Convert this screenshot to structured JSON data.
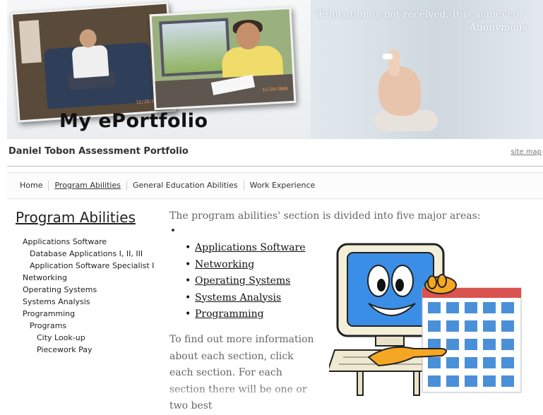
{
  "banner": {
    "title": "My ePortfolio",
    "quote_line1": "“Education is not received. It is achieved.”",
    "quote_line2": "-Anonymous",
    "photo1_stamp": "11/29/2008",
    "photo2_stamp": "11/29/2008"
  },
  "header": {
    "site_title": "Daniel Tobon Assessment Portfolio",
    "site_map": "site map"
  },
  "nav": {
    "items": [
      {
        "label": "Home"
      },
      {
        "label": "Program Abilities"
      },
      {
        "label": "General Education Abilities"
      },
      {
        "label": "Work Experience"
      }
    ]
  },
  "sidebar": {
    "heading": "Program Abilities",
    "items": [
      {
        "label": "Applications Software",
        "level": 1
      },
      {
        "label": "Database Applications I, II, III",
        "level": 2
      },
      {
        "label": "Application Software Specialist I",
        "level": 2
      },
      {
        "label": "Networking",
        "level": 1
      },
      {
        "label": "Operating Systems",
        "level": 1
      },
      {
        "label": "Systems Analysis",
        "level": 1
      },
      {
        "label": "Programming",
        "level": 1
      },
      {
        "label": "Programs",
        "level": 2
      },
      {
        "label": "City Look-up",
        "level": 3
      },
      {
        "label": "Piecework Pay",
        "level": 3
      }
    ]
  },
  "main": {
    "intro": "The program abilities' section is divided into five major areas:",
    "areas": [
      "Applications Software",
      "Networking",
      "Operating Systems",
      "Systems Analysis",
      "Programming"
    ],
    "body": "To find out more information about each section, click each section. For each section there will be one or two best"
  },
  "colors": {
    "text": "#222222",
    "link": "#111111",
    "banner_bg": "#e6ebf0",
    "accent_orange": "#f5a623"
  }
}
